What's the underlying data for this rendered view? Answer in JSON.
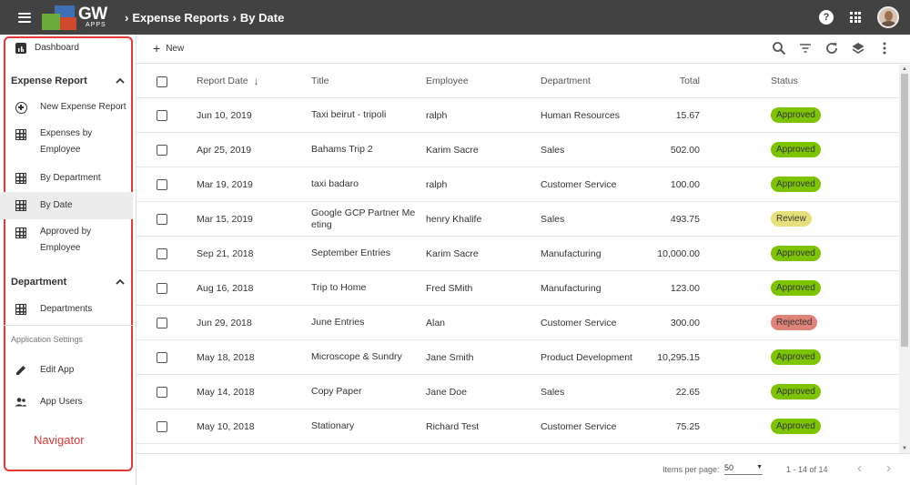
{
  "header": {
    "logo_main": "GW",
    "logo_sub": "APPS",
    "breadcrumb": [
      "Expense Reports",
      "By Date"
    ],
    "help_glyph": "?"
  },
  "sidebar": {
    "dashboard": "Dashboard",
    "expense_section": "Expense Report",
    "expense_items": [
      {
        "label": "New Expense Report",
        "icon": "add-circle-icon"
      },
      {
        "label": "Expenses by\nEmployee",
        "icon": "grid-icon"
      },
      {
        "label": "By Department",
        "icon": "grid-icon"
      },
      {
        "label": "By Date",
        "icon": "grid-icon",
        "active": true
      },
      {
        "label": "Approved by\nEmployee",
        "icon": "grid-icon"
      }
    ],
    "department_section": "Department",
    "department_items": [
      {
        "label": "Departments",
        "icon": "grid-icon"
      }
    ],
    "settings_heading": "Application Settings",
    "settings_items": [
      {
        "label": "Edit App",
        "icon": "pencil-icon"
      },
      {
        "label": "App Users",
        "icon": "users-icon"
      }
    ],
    "annotation_label": "Navigator"
  },
  "toolbar": {
    "new_label": "New",
    "icons": [
      "search-icon",
      "filter-icon",
      "refresh-icon",
      "layers-icon",
      "more-vert-icon"
    ]
  },
  "table": {
    "columns": [
      "Report Date",
      "Title",
      "Employee",
      "Department",
      "Total",
      "Status"
    ],
    "sort_arrow": "↓",
    "rows": [
      {
        "date": "Jun 10, 2019",
        "title": "Taxi beirut - tripoli",
        "employee": "ralph",
        "department": "Human Resources",
        "total": "15.67",
        "status": "Approved"
      },
      {
        "date": "Apr 25, 2019",
        "title": "Bahams Trip 2",
        "employee": "Karim Sacre",
        "department": "Sales",
        "total": "502.00",
        "status": "Approved"
      },
      {
        "date": "Mar 19, 2019",
        "title": "taxi badaro",
        "employee": "ralph",
        "department": "Customer Service",
        "total": "100.00",
        "status": "Approved"
      },
      {
        "date": "Mar 15, 2019",
        "title": "Google GCP Partner Me\neting",
        "employee": "henry Khalife",
        "department": "Sales",
        "total": "493.75",
        "status": "Review"
      },
      {
        "date": "Sep 21, 2018",
        "title": "September Entries",
        "employee": "Karim Sacre",
        "department": "Manufacturing",
        "total": "10,000.00",
        "status": "Approved"
      },
      {
        "date": "Aug 16, 2018",
        "title": "Trip to Home",
        "employee": "Fred SMith",
        "department": "Manufacturing",
        "total": "123.00",
        "status": "Approved"
      },
      {
        "date": "Jun 29, 2018",
        "title": "June Entries",
        "employee": "Alan",
        "department": "Customer Service",
        "total": "300.00",
        "status": "Rejected"
      },
      {
        "date": "May 18, 2018",
        "title": "Microscope & Sundry",
        "employee": "Jane Smith",
        "department": "Product Development",
        "total": "10,295.15",
        "status": "Approved"
      },
      {
        "date": "May 14, 2018",
        "title": "Copy Paper",
        "employee": "Jane Doe",
        "department": "Sales",
        "total": "22.65",
        "status": "Approved"
      },
      {
        "date": "May 10, 2018",
        "title": "Stationary",
        "employee": "Richard Test",
        "department": "Customer Service",
        "total": "75.25",
        "status": "Approved"
      }
    ]
  },
  "status_colors": {
    "Approved": "#7cc400",
    "Review": "#e6e07a",
    "Rejected": "#e0847a"
  },
  "pagination": {
    "items_per_page_label": "Items per page:",
    "items_per_page": "50",
    "range": "1 - 14 of 14",
    "prev_glyph": "‹",
    "next_glyph": "›"
  },
  "colors": {
    "topbar": "#424242",
    "navigator_outline": "#e53935"
  }
}
